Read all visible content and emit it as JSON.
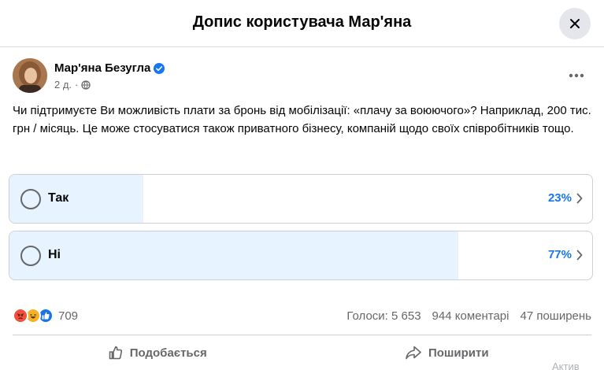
{
  "header": {
    "title": "Допис користувача Мар'яна"
  },
  "post": {
    "author": "Мар'яна Безугла",
    "time": "2 д.",
    "text": "Чи підтримуєте Ви можливість плати за бронь від мобілізації: «плачу за воюючого»? Наприклад, 200 тис. грн / місяць. Це може стосуватися також приватного бізнесу, компаній щодо своїх співробітників тощо."
  },
  "poll": {
    "options": [
      {
        "label": "Так",
        "percent_text": "23%",
        "percent": 23
      },
      {
        "label": "Ні",
        "percent_text": "77%",
        "percent": 77
      }
    ]
  },
  "stats": {
    "reactions_count": "709",
    "votes": "Голоси: 5 653",
    "comments": "944 коментарі",
    "shares": "47 поширень"
  },
  "actions": {
    "like": "Подобається",
    "share": "Поширити"
  },
  "watermark": "Актив",
  "colors": {
    "accent": "#1876f2",
    "poll_fill": "#e7f3ff",
    "muted": "#65676b",
    "verified": "#1876f2"
  },
  "icons": [
    "close-icon",
    "verified-badge-icon",
    "globe-icon",
    "more-icon",
    "chevron-right-icon",
    "angry-reaction-icon",
    "haha-reaction-icon",
    "like-reaction-icon",
    "like-icon",
    "share-icon"
  ]
}
